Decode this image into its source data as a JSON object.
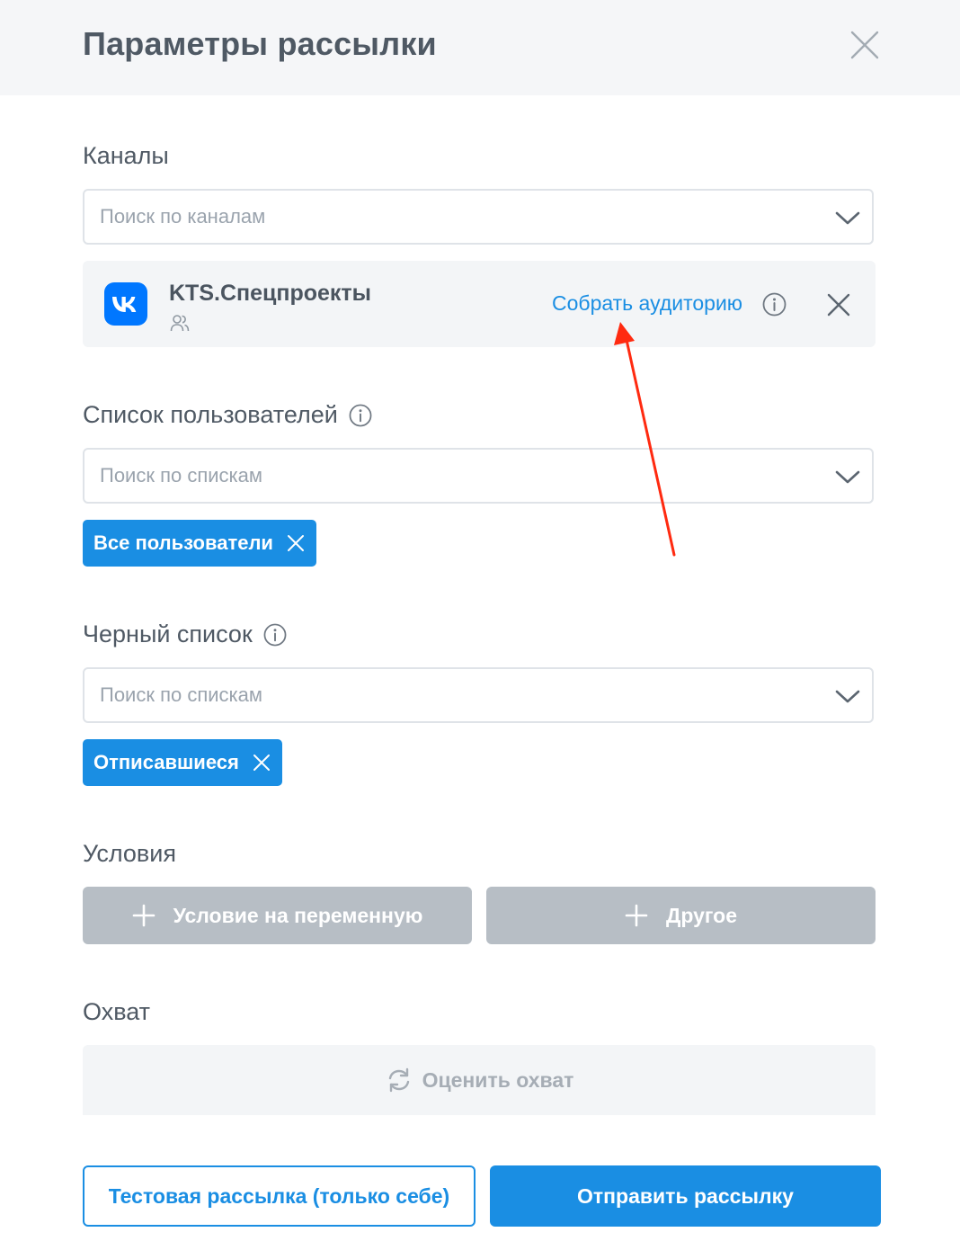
{
  "header": {
    "title": "Параметры рассылки",
    "close_icon": "close-icon"
  },
  "channels": {
    "label": "Каналы",
    "search_placeholder": "Поиск по каналам",
    "selected": {
      "name": "KTS.Спецпроекты",
      "platform_icon": "vk-logo-icon",
      "audience_icon": "users-icon",
      "collect_label": "Собрать аудиторию"
    }
  },
  "user_list": {
    "label": "Список пользователей",
    "search_placeholder": "Поиск по спискам",
    "chips": [
      "Все пользователи"
    ]
  },
  "blacklist": {
    "label": "Черный список",
    "search_placeholder": "Поиск по спискам",
    "chips": [
      "Отписавшиеся"
    ]
  },
  "conditions": {
    "label": "Условия",
    "variable_button": "Условие на переменную",
    "other_button": "Другое"
  },
  "reach": {
    "label": "Охват",
    "estimate_button": "Оценить охват"
  },
  "footer": {
    "test_button": "Тестовая рассылка (только себе)",
    "send_button": "Отправить рассылку"
  },
  "colors": {
    "accent": "#1a8ee3",
    "vk_brand": "#0077ff",
    "annotation_arrow": "#ff2a10",
    "disabled_button": "#b7bec5"
  }
}
